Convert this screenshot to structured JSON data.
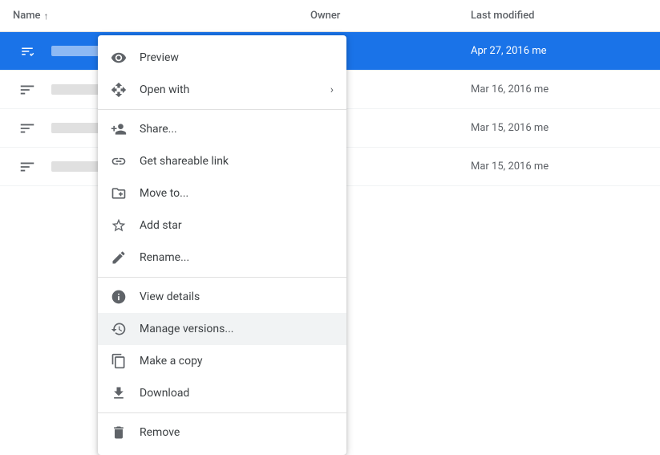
{
  "header": {
    "name_label": "Name",
    "owner_label": "Owner",
    "modified_label": "Last modified",
    "sort_arrow": "↑"
  },
  "files": [
    {
      "id": "row1",
      "selected": true,
      "owner": "me",
      "modified": "Apr 27, 2016 me"
    },
    {
      "id": "row2",
      "selected": false,
      "owner": "me",
      "modified": "Mar 16, 2016 me"
    },
    {
      "id": "row3",
      "selected": false,
      "owner": "me",
      "modified": "Mar 15, 2016 me"
    },
    {
      "id": "row4",
      "selected": false,
      "owner": "me",
      "modified": "Mar 15, 2016 me"
    }
  ],
  "context_menu": {
    "items": [
      {
        "id": "preview",
        "label": "Preview",
        "icon": "eye",
        "has_arrow": false,
        "divider_after": false,
        "highlighted": false
      },
      {
        "id": "open-with",
        "label": "Open with",
        "icon": "open-with",
        "has_arrow": true,
        "divider_after": false,
        "highlighted": false
      },
      {
        "id": "divider1",
        "divider": true
      },
      {
        "id": "share",
        "label": "Share...",
        "icon": "share",
        "has_arrow": false,
        "divider_after": false,
        "highlighted": false
      },
      {
        "id": "get-link",
        "label": "Get shareable link",
        "icon": "link",
        "has_arrow": false,
        "divider_after": false,
        "highlighted": false
      },
      {
        "id": "move-to",
        "label": "Move to...",
        "icon": "move",
        "has_arrow": false,
        "divider_after": false,
        "highlighted": false
      },
      {
        "id": "add-star",
        "label": "Add star",
        "icon": "star",
        "has_arrow": false,
        "divider_after": false,
        "highlighted": false
      },
      {
        "id": "rename",
        "label": "Rename...",
        "icon": "rename",
        "has_arrow": false,
        "divider_after": false,
        "highlighted": false
      },
      {
        "id": "divider2",
        "divider": true
      },
      {
        "id": "view-details",
        "label": "View details",
        "icon": "info",
        "has_arrow": false,
        "divider_after": false,
        "highlighted": false
      },
      {
        "id": "manage-versions",
        "label": "Manage versions...",
        "icon": "versions",
        "has_arrow": false,
        "divider_after": false,
        "highlighted": true
      },
      {
        "id": "make-copy",
        "label": "Make a copy",
        "icon": "copy",
        "has_arrow": false,
        "divider_after": false,
        "highlighted": false
      },
      {
        "id": "download",
        "label": "Download",
        "icon": "download",
        "has_arrow": false,
        "divider_after": false,
        "highlighted": false
      },
      {
        "id": "divider3",
        "divider": true
      },
      {
        "id": "remove",
        "label": "Remove",
        "icon": "trash",
        "has_arrow": false,
        "divider_after": false,
        "highlighted": false
      }
    ]
  }
}
